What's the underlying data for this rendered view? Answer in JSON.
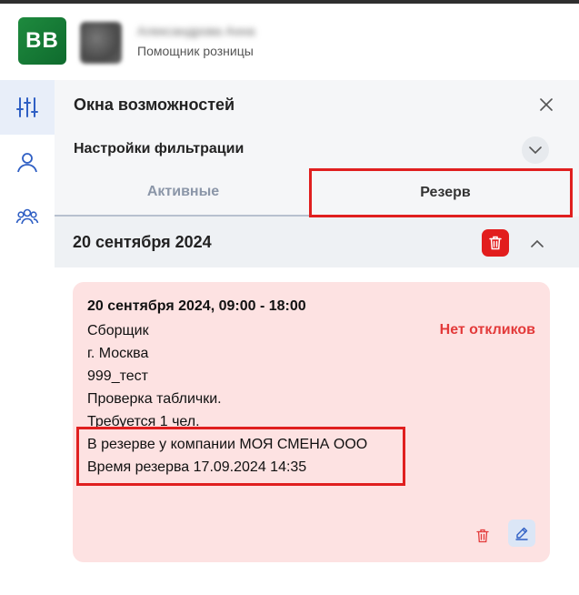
{
  "header": {
    "logo_text": "BB",
    "user_name": "Александрова Анна",
    "user_role": "Помощник розницы"
  },
  "sidebar": {
    "items": [
      {
        "icon": "sliders-icon",
        "active": true
      },
      {
        "icon": "user-icon",
        "active": false
      },
      {
        "icon": "users-icon",
        "active": false
      }
    ]
  },
  "panel": {
    "title": "Окна возможностей",
    "filter_label": "Настройки фильтрации",
    "tabs": [
      {
        "label": "Активные"
      },
      {
        "label": "Резерв"
      }
    ]
  },
  "group": {
    "date": "20 сентября 2024"
  },
  "card": {
    "time": "20 сентября 2024, 09:00 - 18:00",
    "status": "Нет откликов",
    "lines": [
      "Сборщик",
      "г. Москва",
      "999_тест",
      "Проверка таблички.",
      "Требуется 1 чел.",
      "В резерве у компании МОЯ СМЕНА ООО",
      "Время резерва 17.09.2024 14:35"
    ]
  },
  "colors": {
    "accent_blue": "#2f5fc4",
    "danger_red": "#e21d1d",
    "card_bg": "#fde2e2",
    "status_red": "#e33a3a"
  }
}
